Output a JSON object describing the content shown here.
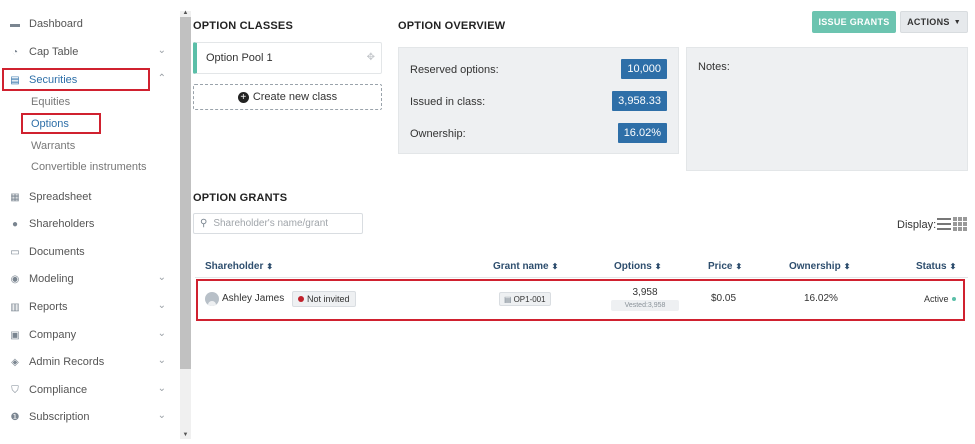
{
  "sidebar": {
    "items": [
      {
        "label": "Dashboard",
        "icon": "dashboard-icon",
        "chevron": false
      },
      {
        "label": "Cap Table",
        "icon": "pie-chart-icon",
        "chevron": true
      },
      {
        "label": "Securities",
        "icon": "clipboard-icon",
        "chevron": true,
        "active": true
      },
      {
        "label": "Spreadsheet",
        "icon": "spreadsheet-icon",
        "chevron": false
      },
      {
        "label": "Shareholders",
        "icon": "user-icon",
        "chevron": false
      },
      {
        "label": "Documents",
        "icon": "document-icon",
        "chevron": false
      },
      {
        "label": "Modeling",
        "icon": "lightbulb-icon",
        "chevron": true
      },
      {
        "label": "Reports",
        "icon": "report-icon",
        "chevron": true
      },
      {
        "label": "Company",
        "icon": "building-icon",
        "chevron": true
      },
      {
        "label": "Admin Records",
        "icon": "admin-icon",
        "chevron": true
      },
      {
        "label": "Compliance",
        "icon": "shield-icon",
        "chevron": true
      },
      {
        "label": "Subscription",
        "icon": "dollar-icon",
        "chevron": true
      }
    ],
    "securities_sub": [
      {
        "label": "Equities"
      },
      {
        "label": "Options",
        "active": true
      },
      {
        "label": "Warrants"
      },
      {
        "label": "Convertible instruments"
      }
    ]
  },
  "option_classes": {
    "title": "OPTION CLASSES",
    "classes": [
      "Option Pool 1"
    ],
    "create_label": "Create new class"
  },
  "overview": {
    "title": "OPTION OVERVIEW",
    "rows": [
      {
        "label": "Reserved options:",
        "value": "10,000"
      },
      {
        "label": "Issued in class:",
        "value": "3,958.33"
      },
      {
        "label": "Ownership:",
        "value": "16.02%"
      }
    ],
    "notes_label": "Notes:"
  },
  "actions": {
    "issue_label": "ISSUE GRANTS",
    "actions_label": "ACTIONS"
  },
  "grants": {
    "title": "OPTION GRANTS",
    "search_placeholder": "Shareholder's name/grant",
    "display_label": "Display:",
    "columns": [
      "Shareholder",
      "Grant name",
      "Options",
      "Price",
      "Ownership",
      "Status"
    ],
    "rows": [
      {
        "shareholder": "Ashley James",
        "invite_status": "Not invited",
        "grant_name": "OP1-001",
        "options": "3,958",
        "vested": "Vested:3,958",
        "price": "$0.05",
        "ownership": "16.02%",
        "status": "Active"
      }
    ]
  },
  "colors": {
    "accent": "#2e6fa8",
    "teal": "#6cc4b0",
    "highlight": "#d0212f",
    "panel": "#eef0f2"
  }
}
